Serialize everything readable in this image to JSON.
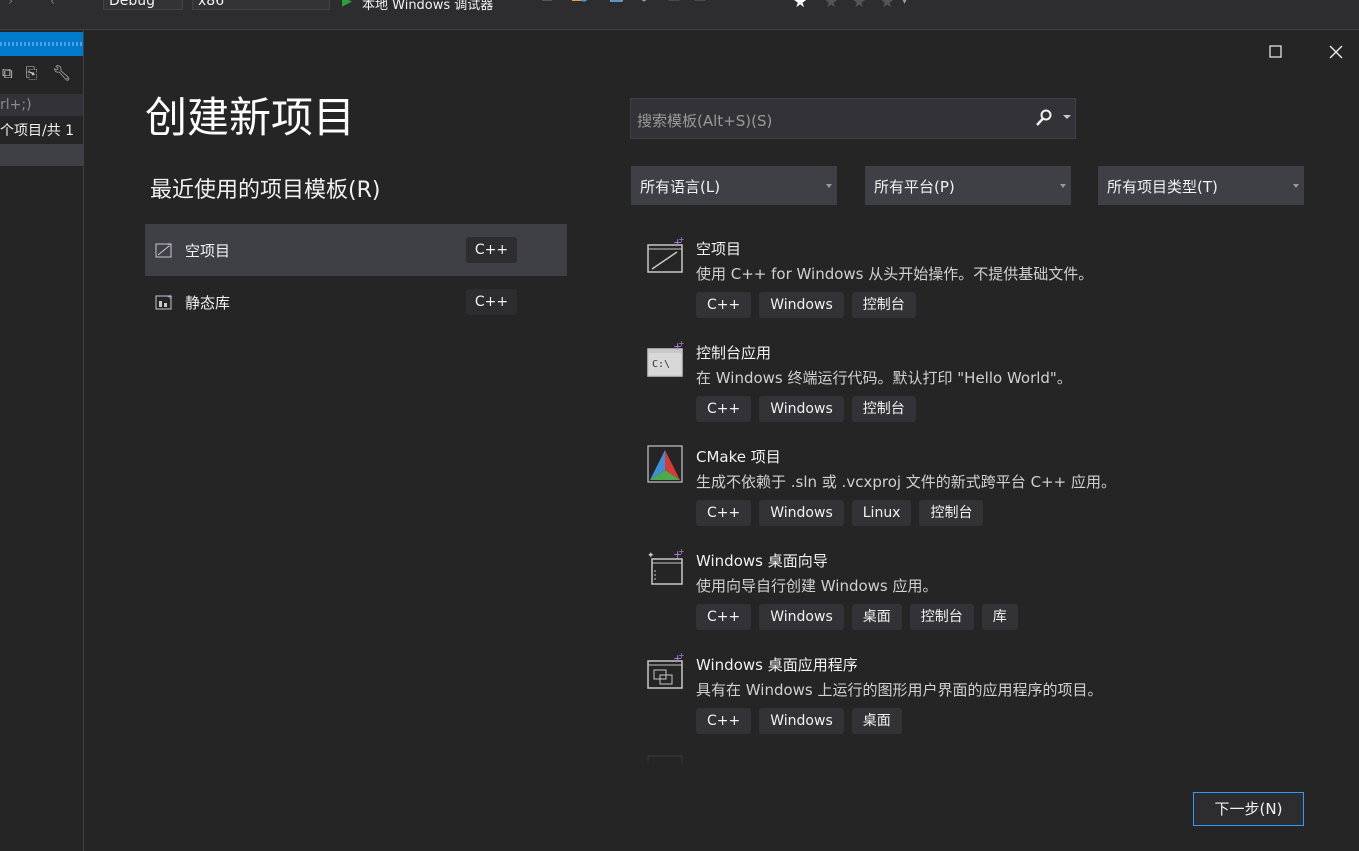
{
  "toolbar": {
    "config": "Debug",
    "platform": "x86",
    "run_label": "本地 Windows 调试器"
  },
  "left_panel": {
    "search_text": "rl+;)",
    "solution_text": "个项目/共 1"
  },
  "dialog": {
    "title": "创建新项目",
    "recent_title": "最近使用的项目模板(R)",
    "recent_items": [
      {
        "label": "空项目",
        "tag": "C++",
        "icon": "empty-project-icon"
      },
      {
        "label": "静态库",
        "tag": "C++",
        "icon": "static-library-icon"
      }
    ],
    "search": {
      "placeholder": "搜索模板(Alt+S)(S)"
    },
    "filters": [
      {
        "label": "所有语言(L)"
      },
      {
        "label": "所有平台(P)"
      },
      {
        "label": "所有项目类型(T)"
      }
    ],
    "templates": [
      {
        "name": "空项目",
        "desc": "使用 C++ for Windows 从头开始操作。不提供基础文件。",
        "tags": [
          "C++",
          "Windows",
          "控制台"
        ],
        "icon": "empty-project-icon"
      },
      {
        "name": "控制台应用",
        "desc": "在 Windows 终端运行代码。默认打印 \"Hello World\"。",
        "tags": [
          "C++",
          "Windows",
          "控制台"
        ],
        "icon": "console-app-icon"
      },
      {
        "name": "CMake 项目",
        "desc": "生成不依赖于 .sln 或 .vcxproj 文件的新式跨平台 C++ 应用。",
        "tags": [
          "C++",
          "Windows",
          "Linux",
          "控制台"
        ],
        "icon": "cmake-icon"
      },
      {
        "name": "Windows 桌面向导",
        "desc": "使用向导自行创建 Windows 应用。",
        "tags": [
          "C++",
          "Windows",
          "桌面",
          "控制台",
          "库"
        ],
        "icon": "desktop-wizard-icon"
      },
      {
        "name": "Windows 桌面应用程序",
        "desc": "具有在 Windows 上运行的图形用户界面的应用程序的项目。",
        "tags": [
          "C++",
          "Windows",
          "桌面"
        ],
        "icon": "desktop-app-icon"
      }
    ],
    "next_button": "下一步(N)"
  },
  "colors": {
    "accent": "#007acc",
    "background": "#252526",
    "selected": "#3f3f46",
    "focus_border": "#3399ff",
    "plus": "#b180d7"
  }
}
